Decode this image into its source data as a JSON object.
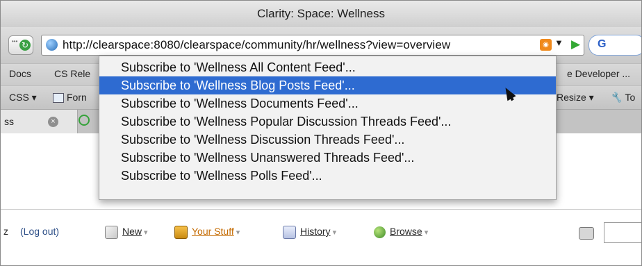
{
  "window": {
    "title": "Clarity: Space: Wellness"
  },
  "navbar": {
    "url": "http://clearspace:8080/clearspace/community/hr/wellness?view=overview",
    "search_letter": "G"
  },
  "bookmarks": {
    "docs": "Docs",
    "cs_rele": "CS Rele",
    "dev": "e Developer ..."
  },
  "webdev_toolbar": {
    "css": "CSS ▾",
    "forms": "Forn",
    "resize": "Resize ▾",
    "tools": "To"
  },
  "tab": {
    "label": "ss",
    "close": "×"
  },
  "rss_menu": {
    "items": [
      "Subscribe to 'Wellness All Content Feed'...",
      "Subscribe to 'Wellness Blog Posts Feed'...",
      "Subscribe to 'Wellness Documents Feed'...",
      "Subscribe to 'Wellness Popular Discussion Threads Feed'...",
      "Subscribe to 'Wellness Discussion Threads Feed'...",
      "Subscribe to 'Wellness Unanswered Threads Feed'...",
      "Subscribe to 'Wellness Polls Feed'..."
    ],
    "selected_index": 1
  },
  "pagebar": {
    "user_tail": "z",
    "logout": "(Log out)",
    "new": "New",
    "your_stuff": "Your Stuff",
    "history": "History",
    "browse": "Browse"
  },
  "colors": {
    "selection": "#2e6bd1",
    "rss": "#f08a1c",
    "your_stuff": "#c46a00"
  }
}
